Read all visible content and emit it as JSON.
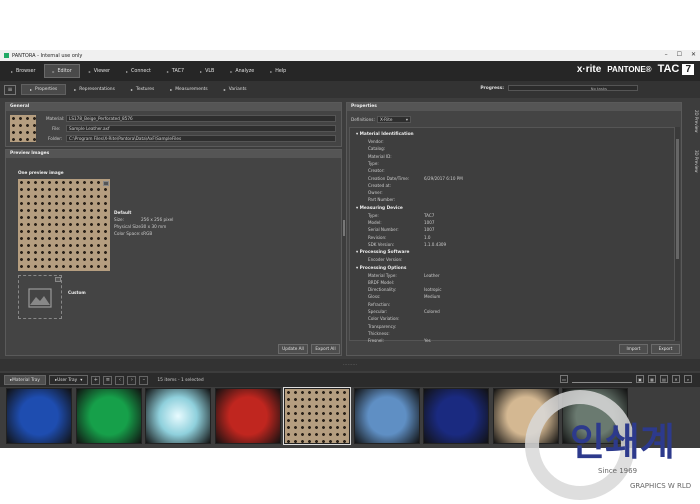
{
  "window": {
    "title": "PANTORA - Internal use only",
    "controls": [
      "–",
      "☐",
      "✕"
    ]
  },
  "menu": {
    "items": [
      {
        "label": "Browser",
        "active": false
      },
      {
        "label": "Editor",
        "active": true
      },
      {
        "label": "Viewer",
        "active": false
      },
      {
        "label": "Connect",
        "active": false
      },
      {
        "label": "TAC7",
        "active": false
      },
      {
        "label": "VLB",
        "active": false
      },
      {
        "label": "Analyze",
        "active": false
      },
      {
        "label": "Help",
        "active": false
      }
    ]
  },
  "brand": {
    "xrite": "x·rite",
    "pantone": "PANTONE®",
    "tac": "TAC",
    "seven": "7"
  },
  "subtabs": [
    "Properties",
    "Representations",
    "Textures",
    "Measurements",
    "Variants"
  ],
  "progress": {
    "label": "Progress:",
    "value": "No tasks"
  },
  "general": {
    "header": "General",
    "material_label": "Material:",
    "material_value": "LS178_Beige_Perforated_8576",
    "file_label": "File:",
    "file_value": "Sample Leather.axf",
    "folder_label": "Folder:",
    "folder_value": "C:\\Program Files\\X-Rite\\Pantora\\Data\\AxF\\SampleFiles"
  },
  "preview": {
    "header": "Preview Images",
    "one_label": "One preview image",
    "default_title": "Default",
    "size_label": "Size:",
    "size_value": "256 x 256 pixel",
    "phys_label": "Physical Size:",
    "phys_value": "30 x 30 mm",
    "cs_label": "Color Space:",
    "cs_value": "sRGB",
    "custom_label": "Custom",
    "update_all": "Update All",
    "export_all": "Export All"
  },
  "properties": {
    "header": "Properties",
    "definitions_label": "Definitions:",
    "definitions_value": "X-Rite",
    "sections": [
      {
        "title": "Material Identification",
        "rows": [
          [
            "Vendor:",
            ""
          ],
          [
            "Catalog:",
            ""
          ],
          [
            "Material ID:",
            ""
          ],
          [
            "Type:",
            ""
          ],
          [
            "Creator:",
            ""
          ],
          [
            "Creation Date/Time:",
            "6/29/2017 6:10 PM"
          ],
          [
            "Created at:",
            ""
          ],
          [
            "Owner:",
            ""
          ],
          [
            "Part Number:",
            ""
          ]
        ]
      },
      {
        "title": "Measuring Device",
        "rows": [
          [
            "Type:",
            "TAC7"
          ],
          [
            "Model:",
            "1007"
          ],
          [
            "Serial Number:",
            "1007"
          ],
          [
            "Revision:",
            "1.0"
          ],
          [
            "SDK Version:",
            "1.1.0.4309"
          ]
        ]
      },
      {
        "title": "Processing Software",
        "rows": [
          [
            "Encoder Version:",
            ""
          ]
        ]
      },
      {
        "title": "Processing Options",
        "rows": [
          [
            "Material Type:",
            "Leather"
          ],
          [
            "BRDF Model:",
            ""
          ],
          [
            "Directionality:",
            "Isotropic"
          ],
          [
            "Gloss:",
            "Medium"
          ],
          [
            "Refraction:",
            ""
          ],
          [
            "Specular:",
            "Colored"
          ],
          [
            "Color Variation:",
            ""
          ],
          [
            "Transparency:",
            ""
          ],
          [
            "Thickness:",
            ""
          ],
          [
            "Fresnel:",
            "Yes"
          ]
        ]
      }
    ],
    "import": "Import",
    "export": "Export"
  },
  "side_tabs": [
    "2D Preview",
    "3D Preview"
  ],
  "tray": {
    "material_tray": "Material Tray",
    "user_tray": "User Tray",
    "status": "15 items - 1 selected",
    "splitter": "·········",
    "thumbnails": [
      {
        "name": "blue-dark",
        "color": "#1e4db0"
      },
      {
        "name": "green",
        "color": "#16a04a"
      },
      {
        "name": "teal-light",
        "color": "#8fd0dc"
      },
      {
        "name": "red",
        "color": "#c0261f"
      },
      {
        "name": "beige-perforated",
        "color": "#b59e80"
      },
      {
        "name": "light-blue",
        "color": "#5f8fc4"
      },
      {
        "name": "navy-sparkle",
        "color": "#1a2a80"
      },
      {
        "name": "beige-gold",
        "color": "#d4b892"
      },
      {
        "name": "grey-green",
        "color": "#6a7a70"
      }
    ]
  },
  "watermark": {
    "text": "인쇄계",
    "since": "Since 1969",
    "sub": "GRAPHICS W RLD"
  }
}
